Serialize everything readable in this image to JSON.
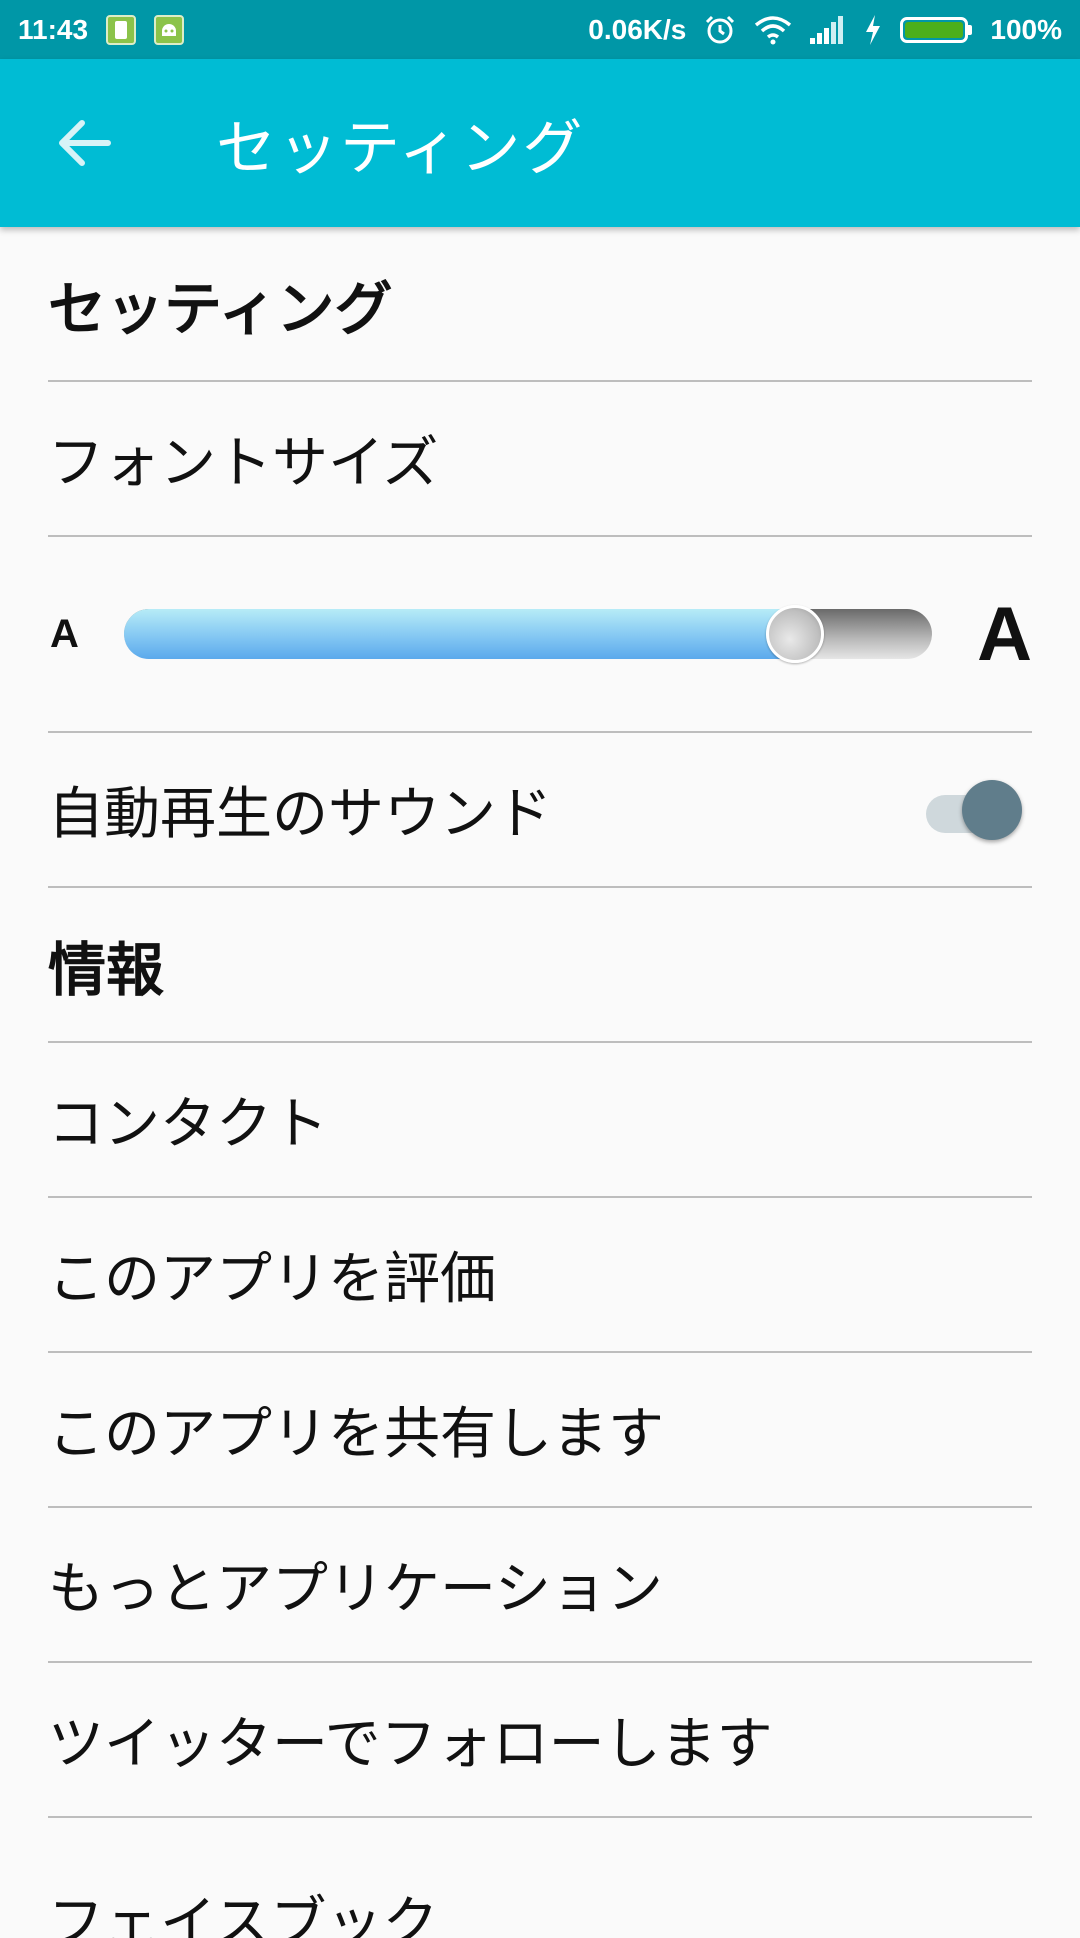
{
  "status_bar": {
    "time": "11:43",
    "network_speed": "0.06K/s",
    "battery_level": "100%",
    "icons": [
      "sim-card-icon",
      "android-debug-icon",
      "alarm-icon",
      "wifi-icon",
      "signal-icon",
      "charging-icon",
      "battery-icon"
    ]
  },
  "app_bar": {
    "title": "セッティング",
    "back_icon": "arrow-back-icon"
  },
  "settings": {
    "section_settings": "セッティング",
    "font_size": "フォントサイズ",
    "slider": {
      "small_label": "A",
      "large_label": "A",
      "value_percent": 83
    },
    "autoplay_sound": {
      "label": "自動再生のサウンド",
      "enabled": true
    },
    "section_info": "情報",
    "contact": "コンタクト",
    "rate_app": "このアプリを評価",
    "share_app": "このアプリを共有します",
    "more_apps": "もっとアプリケーション",
    "follow_twitter": "ツイッターでフォローします",
    "facebook": "フェイスブック"
  },
  "colors": {
    "status_bar": "#0097a7",
    "app_bar": "#00bcd4",
    "switch_thumb": "#607d8b",
    "slider_fill": "#7fc4f2"
  }
}
